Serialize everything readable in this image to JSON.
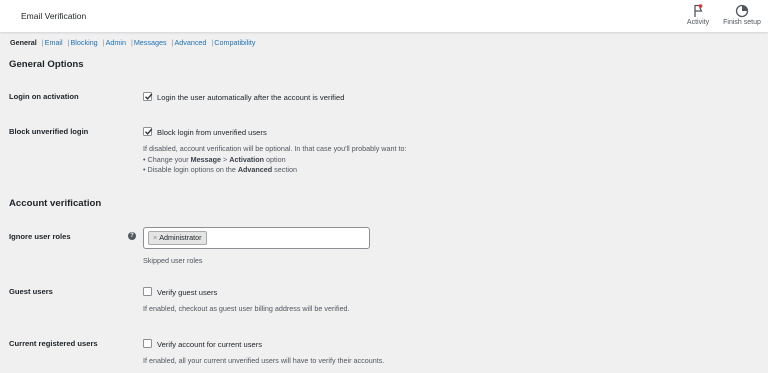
{
  "header": {
    "title": "Email Verification",
    "activity_label": "Activity",
    "finish_setup_label": "Finish setup"
  },
  "subnav": {
    "items": [
      "General",
      "Email",
      "Blocking",
      "Admin",
      "Messages",
      "Advanced",
      "Compatibility"
    ],
    "separator": "|",
    "current": "General"
  },
  "general": {
    "heading": "General Options",
    "login_on_activation": {
      "label": "Login on activation",
      "checkbox_label": "Login the user automatically after the account is verified",
      "checked": true
    },
    "block_unverified": {
      "label": "Block unverified login",
      "checkbox_label": "Block login from unverified users",
      "checked": true,
      "desc_line1": "If disabled, account verification will be optional. In that case you'll probably want to:",
      "desc_line2_prefix": "• Change your ",
      "desc_line2_bold1": "Message",
      "desc_line2_mid": " > ",
      "desc_line2_bold2": "Activation",
      "desc_line2_suffix": " option",
      "desc_line3_prefix": "• Disable login options on the ",
      "desc_line3_bold": "Advanced",
      "desc_line3_suffix": " section"
    }
  },
  "account": {
    "heading": "Account verification",
    "ignore_roles": {
      "label": "Ignore user roles",
      "help_icon": "?",
      "tag_remove": "×",
      "tag": "Administrator",
      "desc": "Skipped user roles"
    },
    "guest_users": {
      "label": "Guest users",
      "checkbox_label": "Verify guest users",
      "checked": false,
      "desc": "If enabled, checkout as guest user billing address will be verified."
    },
    "current_users": {
      "label": "Current registered users",
      "checkbox_label": "Verify account for current users",
      "checked": false,
      "desc": "If enabled, all your current unverified users will have to verify their accounts."
    }
  },
  "icons": {
    "activity": "flag-icon",
    "finish_setup": "progress-circle-icon",
    "checkmark": "checkmark-icon",
    "help": "help-icon"
  },
  "colors": {
    "background": "#f0f0f1",
    "link": "#2271b1",
    "text": "#1d2327",
    "muted": "#50575e",
    "flag_accent": "#d63638"
  }
}
